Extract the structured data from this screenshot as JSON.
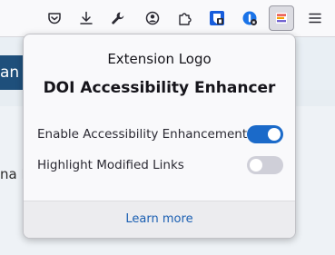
{
  "toolbar": {
    "icons": [
      "pocket-icon",
      "download-icon",
      "wrench-icon",
      "account-icon",
      "extensions-icon",
      "bitwarden-icon",
      "one-password-icon",
      "doi-extension-icon",
      "hamburger-menu-icon"
    ],
    "active_icon": "doi-extension-icon"
  },
  "page": {
    "strip_text": "an A",
    "body_text": "na I"
  },
  "popup": {
    "logo_text": "Extension Logo",
    "title": "DOI Accessibility Enhancer",
    "settings": [
      {
        "label": "Enable Accessibility Enhancements",
        "enabled": true
      },
      {
        "label": "Highlight Modified Links",
        "enabled": false
      }
    ],
    "footer_link": "Learn more"
  },
  "colors": {
    "toggle_on": "#1b6ac9",
    "toggle_off": "#cfcfd8",
    "link": "#1b5fb2",
    "page_header": "#1e4f7b"
  }
}
